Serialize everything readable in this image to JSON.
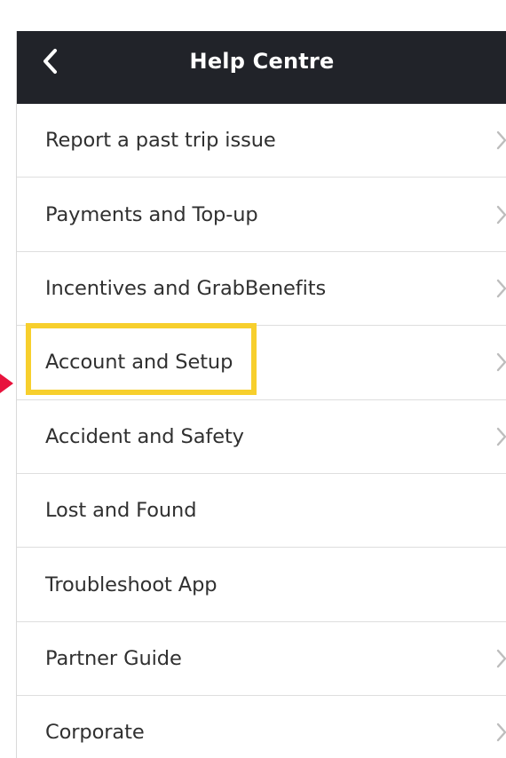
{
  "header": {
    "title": "Help Centre",
    "back_icon": "chevron-left-icon"
  },
  "menu": {
    "items": [
      {
        "label": "Report a past trip issue",
        "has_chevron": true
      },
      {
        "label": "Payments and Top-up",
        "has_chevron": true
      },
      {
        "label": "Incentives and GrabBenefits",
        "has_chevron": true
      },
      {
        "label": "Account and Setup",
        "has_chevron": true,
        "highlighted": true
      },
      {
        "label": "Accident and Safety",
        "has_chevron": true
      },
      {
        "label": "Lost and Found",
        "has_chevron": false
      },
      {
        "label": "Troubleshoot App",
        "has_chevron": false
      },
      {
        "label": "Partner Guide",
        "has_chevron": true
      },
      {
        "label": "Corporate",
        "has_chevron": true
      }
    ]
  },
  "colors": {
    "header_background": "#212329",
    "highlight": "#f7cf2d",
    "pointer": "#e8133d",
    "chevron": "#bdbdbd"
  }
}
